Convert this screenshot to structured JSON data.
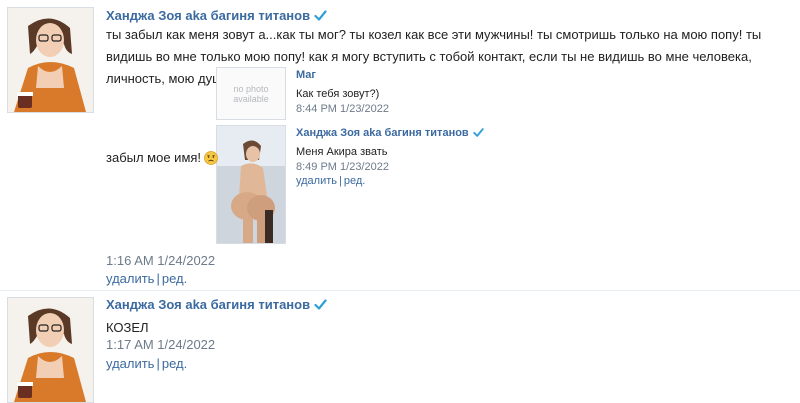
{
  "post1": {
    "author": "Ханджа Зоя aka багиня титанов",
    "text": "ты забыл как меня зовут а...как ты мог? ты козел как все эти мужчины! ты смотришь только на мою попу! ты видишь во мне только мою попу! как я могу вступить с тобой контакт, если ты не видишь во мне человека, личность, мою душу, ты",
    "text_tail": "забыл мое имя!",
    "timestamp": "1:16 AM 1/24/2022",
    "delete_label": "удалить",
    "sep": "|",
    "edit_label": "ред.",
    "quote1": {
      "thumb_text_line1": "no photo",
      "thumb_text_line2": "available",
      "author": "Маг",
      "text": "Как тебя зовут?)",
      "timestamp": "8:44 PM 1/23/2022"
    },
    "quote2": {
      "author": "Ханджа Зоя aka багиня титанов",
      "text": "Меня Акира звать",
      "timestamp": "8:49 PM 1/23/2022",
      "delete_label": "удалить",
      "sep": "|",
      "edit_label": "ред."
    }
  },
  "post2": {
    "author": "Ханджа Зоя aka багиня титанов",
    "text": "КОЗЕЛ",
    "timestamp": "1:17 AM 1/24/2022",
    "delete_label": "удалить",
    "sep": "|",
    "edit_label": "ред."
  },
  "colors": {
    "link": "#3b6aa0",
    "verified": "#2f9fd6",
    "meta": "#6d7b8a"
  },
  "icons": {
    "verified": "verified-check-icon",
    "emoji": "worried-face-emoji-icon"
  }
}
